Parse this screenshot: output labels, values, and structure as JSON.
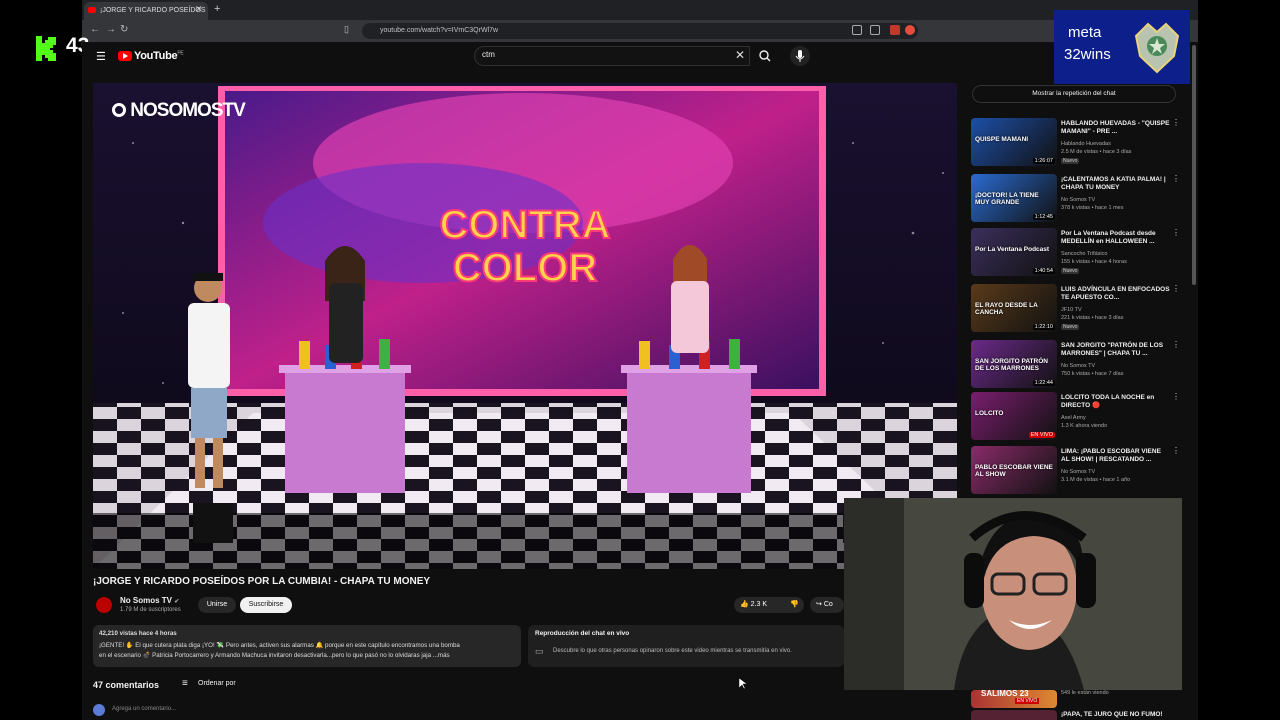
{
  "kick": {
    "count": "43"
  },
  "meta": {
    "line1": "meta",
    "line2": "32wins"
  },
  "browser": {
    "tab_title": "¡JORGE Y RICARDO POSEÍDOS",
    "url": "youtube.com/watch?v=IVmC3QrWl7w"
  },
  "header": {
    "logo_text": "YouTube",
    "logo_sup": "PE",
    "search_value": "ctm"
  },
  "video": {
    "overlay_brand": "NOSOMOSTV",
    "title": "¡JORGE Y RICARDO POSEÍDOS POR LA CUMBIA! - CHAPA TU MONEY",
    "set_title_1": "CONTRA",
    "set_title_2": "COLOR"
  },
  "channel": {
    "name": "No Somos TV",
    "subs": "1.79 M de suscriptores",
    "join_label": "Unirse",
    "subscribe_label": "Suscribirse",
    "likes": "2.3 K",
    "share_label": "Co"
  },
  "description": {
    "meta": "42,210 vistas  hace 4 horas",
    "line1": "¡GENTE! ✋ El que cutera plata diga ¡YO! 💸 Pero antes, activen sus alarmas 🔔 porque en este capítulo encontramos una bomba",
    "line2": "en el escenario 💣 Patricia Portocarrero y Armando Machuca invitaron desactivarla...pero lo que pasó no lo olvidaras jaja  ...más"
  },
  "chat_replay": {
    "title": "Reproducción del chat en vivo",
    "text": "Descubre lo que otras personas opinaron sobre este video mientras se transmitía en vivo."
  },
  "comments": {
    "count_label": "47 comentarios",
    "sort_label": "Ordenar por",
    "add_placeholder": "Agrega un comentario..."
  },
  "sidebar": {
    "chat_toggle_label": "Mostrar la repetición del chat",
    "items": [
      {
        "title": "HABLANDO HUEVADAS - \"QUISPE MAMANI\" - PRE ...",
        "channel": "Hablando Huevadas",
        "meta": "2.5 M de vistas • hace 3 días",
        "duration": "1:26:07",
        "badge": "Nuevo",
        "thumb_text": "QUISPE MAMANI",
        "thumb_color": "#1d4fa8"
      },
      {
        "title": "¡CALENTAMOS A KATIA PALMA! | CHAPA TU MONEY",
        "channel": "No Somos TV",
        "meta": "378 k vistas • hace 1 mes",
        "duration": "1:12:45",
        "badge": "",
        "thumb_text": "¡DOCTOR! LA TIENE MUY GRANDE",
        "thumb_color": "#2a6bd1"
      },
      {
        "title": "Por La Ventana Podcast desde MEDELLÍN en HALLOWEEN ...",
        "channel": "Sancocho Trifásico",
        "meta": "155 k vistas • hace 4 horas",
        "duration": "1:40:54",
        "badge": "Nuevo",
        "thumb_text": "Por La Ventana Podcast",
        "thumb_color": "#3b2f5c"
      },
      {
        "title": "LUIS ADVÍNCULA EN ENFOCADOS TE APUESTO CO...",
        "channel": "JF10 TV",
        "meta": "221 k vistas • hace 3 días",
        "duration": "1:22:10",
        "badge": "Nuevo",
        "thumb_text": "EL RAYO DESDE LA CANCHA",
        "thumb_color": "#5a3a1a"
      },
      {
        "title": "SAN JORGITO \"PATRÓN DE LOS MARRONES\" | CHAPA TU ...",
        "channel": "No Somos TV",
        "meta": "750 k vistas • hace 7 días",
        "duration": "1:22:44",
        "badge": "",
        "thumb_text": "SAN JORGITO PATRÓN DE LOS MARRONES",
        "thumb_color": "#6b2a8a"
      },
      {
        "title": "LOLCITO TODA LA NOCHE en DIRECTO 🔴",
        "channel": "Axel Army",
        "meta": "1.3 K ahora viendo",
        "duration": "EN VIVO",
        "badge": "",
        "thumb_text": "LOLCITO",
        "thumb_color": "#7a1e6e"
      },
      {
        "title": "LIMA: ¡PABLO ESCOBAR VIENE AL SHOW! | RESCATANDO ...",
        "channel": "No Somos TV",
        "meta": "3.1 M de vistas • hace 1 año",
        "duration": "",
        "badge": "",
        "thumb_text": "PABLO ESCOBAR VIENE AL SHOW",
        "thumb_color": "#8a2b6a"
      }
    ],
    "partial_1_meta": "549 le están viendo",
    "partial_1_thumb": "SALIMOS 23",
    "partial_1_badge": "EN VIVO",
    "partial_2_title": "¡PAPA, TE JURO QUE NO FUMO!"
  }
}
